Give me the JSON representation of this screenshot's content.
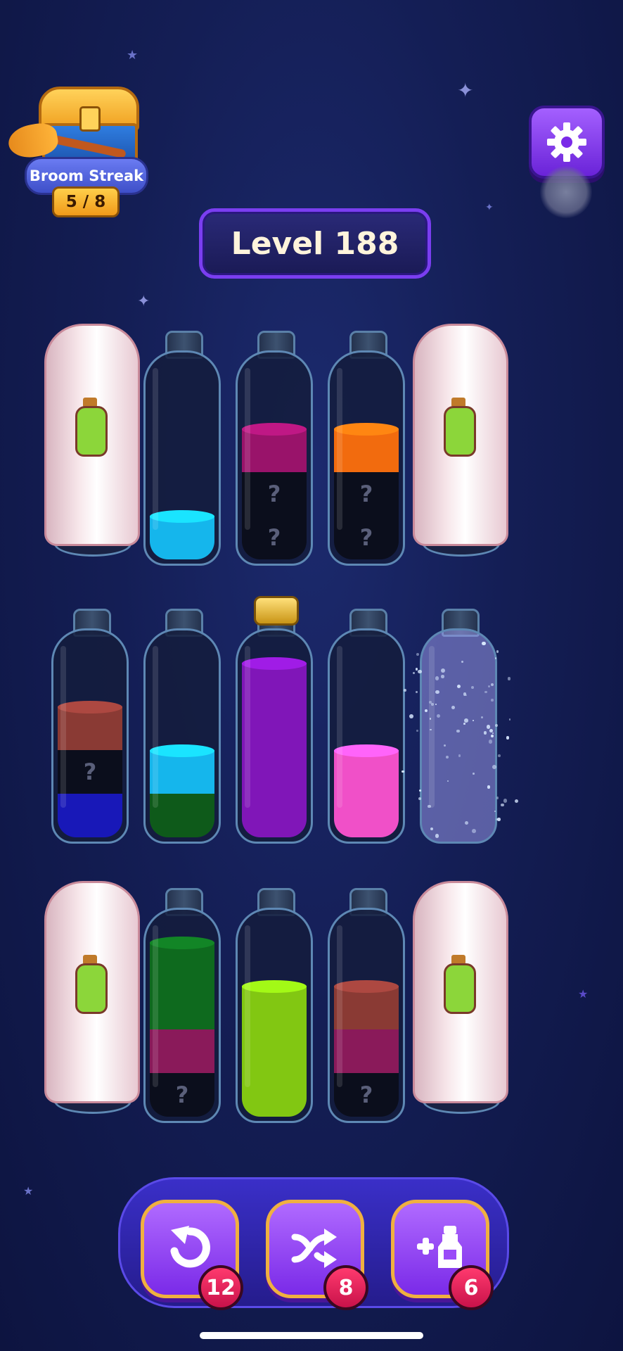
{
  "streak": {
    "label": "Broom Streak",
    "count": "5 / 8"
  },
  "level": {
    "label": "Level 188"
  },
  "settings": {
    "icon": "gear-icon"
  },
  "hidden_marker": "?",
  "bottles": [
    {
      "kind": "ghost",
      "layers": []
    },
    {
      "kind": "glass",
      "layers": [
        {
          "color": "#15b6ec"
        }
      ]
    },
    {
      "kind": "glass",
      "layers": [
        {
          "hidden": true
        },
        {
          "hidden": true
        },
        {
          "color": "#99136a"
        }
      ]
    },
    {
      "kind": "glass",
      "layers": [
        {
          "hidden": true
        },
        {
          "hidden": true
        },
        {
          "color": "#f26b0e"
        }
      ]
    },
    {
      "kind": "ghost",
      "layers": []
    },
    {
      "kind": "glass",
      "layers": [
        {
          "color": "#1818b8"
        },
        {
          "hidden": true
        },
        {
          "color": "#8a3a34"
        }
      ]
    },
    {
      "kind": "glass",
      "layers": [
        {
          "color": "#0e5a1a"
        },
        {
          "color": "#15b6ec"
        }
      ]
    },
    {
      "kind": "glass",
      "corked": true,
      "layers": [
        {
          "color": "#8016b8"
        },
        {
          "color": "#8016b8"
        },
        {
          "color": "#8016b8"
        },
        {
          "color": "#8016b8"
        }
      ]
    },
    {
      "kind": "glass",
      "layers": [
        {
          "color": "#f050c8"
        },
        {
          "color": "#f050c8"
        }
      ]
    },
    {
      "kind": "glass",
      "sparkling": true,
      "layers": []
    },
    {
      "kind": "ghost",
      "layers": []
    },
    {
      "kind": "glass",
      "layers": [
        {
          "hidden": true
        },
        {
          "color": "#8a1a5a"
        },
        {
          "color": "#0e6a1e"
        },
        {
          "color": "#0e6a1e"
        }
      ]
    },
    {
      "kind": "glass",
      "layers": [
        {
          "color": "#82c712"
        },
        {
          "color": "#82c712"
        },
        {
          "color": "#82c712"
        }
      ]
    },
    {
      "kind": "glass",
      "layers": [
        {
          "hidden": true
        },
        {
          "color": "#8a1a5a"
        },
        {
          "color": "#8a3a34"
        }
      ]
    },
    {
      "kind": "ghost",
      "layers": []
    }
  ],
  "powerups": [
    {
      "name": "undo",
      "icon": "undo-icon",
      "count": "12"
    },
    {
      "name": "shuffle",
      "icon": "shuffle-icon",
      "count": "8"
    },
    {
      "name": "add-bottle",
      "icon": "add-bottle-icon",
      "count": "6"
    }
  ]
}
